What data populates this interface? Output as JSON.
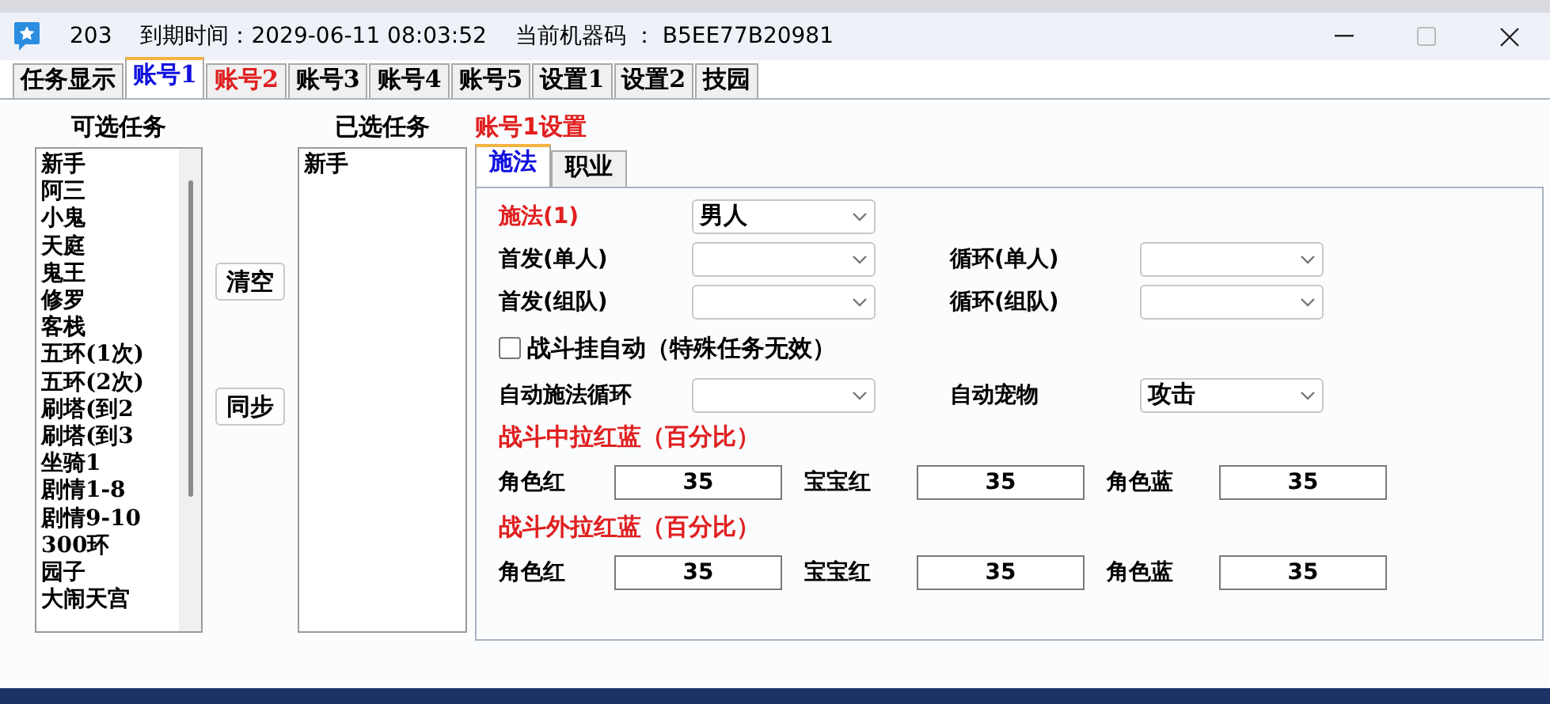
{
  "title_bar": {
    "app_number": "203",
    "expiry": "到期时间：2029-06-11 08:03:52",
    "machine_code": "当前机器码 ： B5EE77B20981"
  },
  "tabs": [
    {
      "label": "任务显示",
      "selected": false,
      "color": "#000000"
    },
    {
      "label": "账号1",
      "selected": true,
      "color": "#1010e0"
    },
    {
      "label": "账号2",
      "selected": false,
      "color": "#e02020"
    },
    {
      "label": "账号3",
      "selected": false,
      "color": "#000000"
    },
    {
      "label": "账号4",
      "selected": false,
      "color": "#000000"
    },
    {
      "label": "账号5",
      "selected": false,
      "color": "#000000"
    },
    {
      "label": "设置1",
      "selected": false,
      "color": "#000000"
    },
    {
      "label": "设置2",
      "selected": false,
      "color": "#000000"
    },
    {
      "label": "技园",
      "selected": false,
      "color": "#000000"
    }
  ],
  "available_tasks": {
    "heading": "可选任务",
    "items": [
      "新手",
      "阿三",
      "小鬼",
      "天庭",
      "鬼王",
      "修罗",
      "客栈",
      "五环(1次)",
      "五环(2次)",
      "刷塔(到2",
      "刷塔(到3",
      "坐骑1",
      "剧情1-8",
      "剧情9-10",
      "300环",
      "园子",
      "大闹天宫"
    ]
  },
  "actions": [
    "清空",
    "同步"
  ],
  "selected_tasks": {
    "heading": "已选任务",
    "items": [
      "新手"
    ]
  },
  "settings": {
    "heading": "账号1设置",
    "subtabs": [
      {
        "label": "施法",
        "selected": true
      },
      {
        "label": "职业",
        "selected": false
      }
    ],
    "rows": [
      {
        "kind": "combos",
        "fields": [
          {
            "label": "施法(1)",
            "color": "#e02020",
            "value": "男人"
          }
        ]
      },
      {
        "kind": "combos",
        "fields": [
          {
            "label": "首发(单人)",
            "color": "#000000"
          },
          {
            "label": "循环(单人)",
            "color": "#000000"
          }
        ]
      },
      {
        "kind": "combos",
        "fields": [
          {
            "label": "首发(组队)",
            "color": "#000000"
          },
          {
            "label": "循环(组队)",
            "color": "#000000"
          }
        ]
      },
      {
        "kind": "checkbox",
        "label": "战斗挂自动（特殊任务无效）",
        "checked": false
      },
      {
        "kind": "combos",
        "fields": [
          {
            "label": "自动施法循环",
            "color": "#000000"
          },
          {
            "label": "自动宠物",
            "color": "#000000",
            "value": "攻击"
          }
        ]
      },
      {
        "kind": "heading",
        "text": "战斗中拉红蓝（百分比）"
      },
      {
        "kind": "numbers",
        "fields": [
          {
            "label": "角色红",
            "value": "35"
          },
          {
            "label": "宝宝红",
            "value": "35"
          },
          {
            "label": "角色蓝",
            "value": "35"
          }
        ]
      },
      {
        "kind": "heading",
        "text": "战斗外拉红蓝（百分比）"
      },
      {
        "kind": "numbers",
        "fields": [
          {
            "label": "角色红",
            "value": "35"
          },
          {
            "label": "宝宝红",
            "value": "35"
          },
          {
            "label": "角色蓝",
            "value": "35"
          }
        ]
      }
    ]
  }
}
